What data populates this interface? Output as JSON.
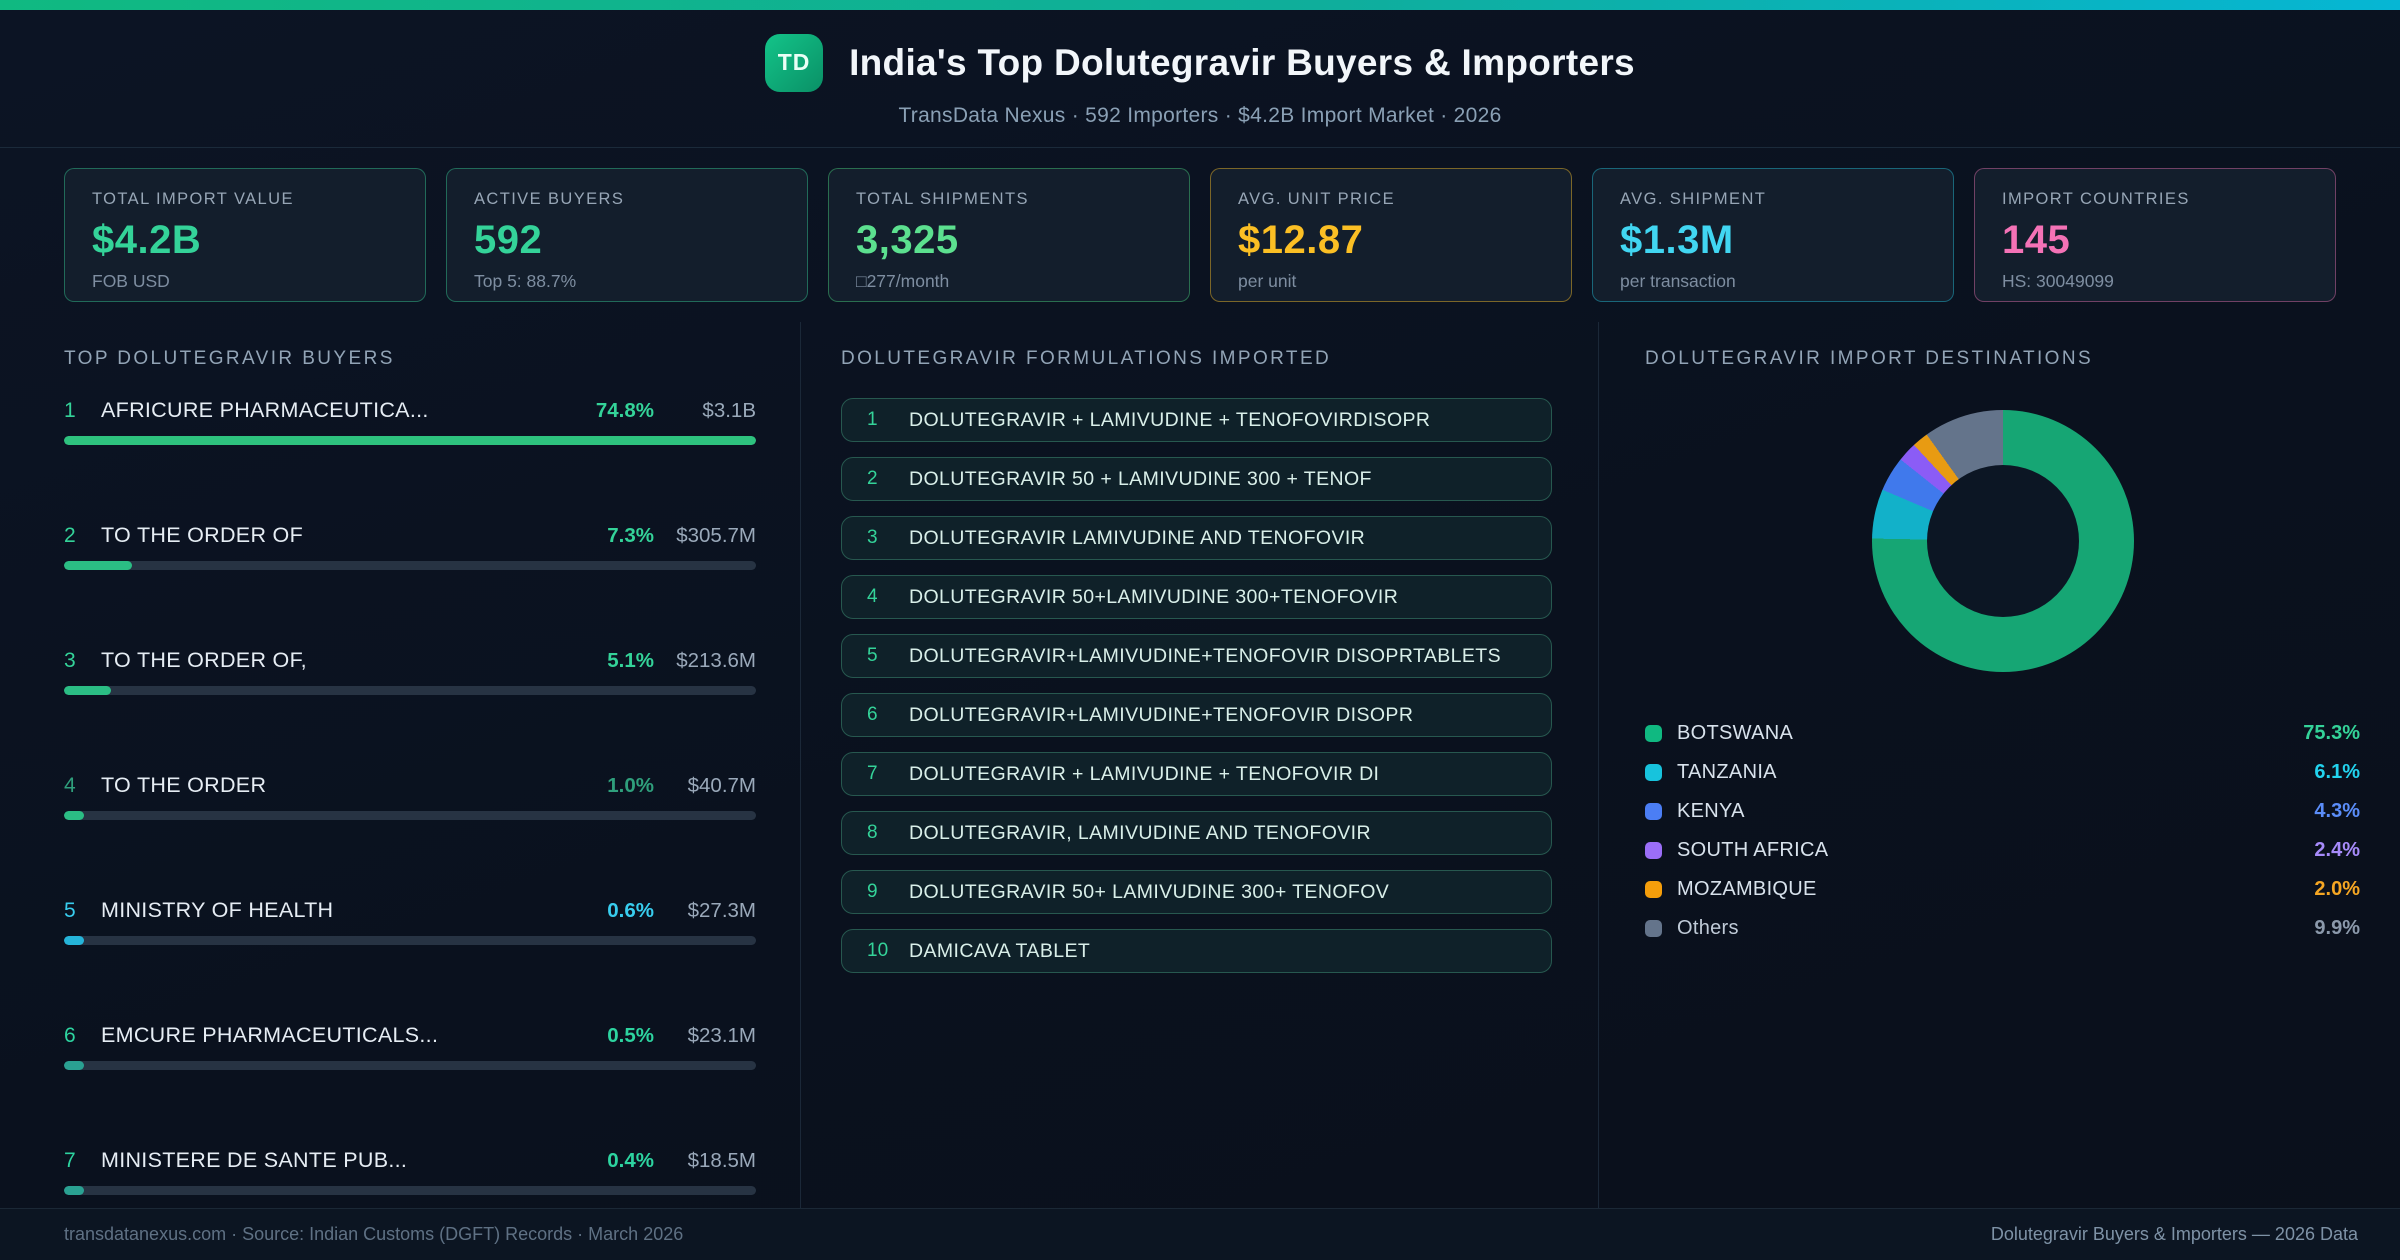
{
  "header": {
    "badge": "TD",
    "title": "India's Top Dolutegravir Buyers & Importers",
    "subtitle": "TransData Nexus · 592 Importers · $4.2B Import Market · 2026"
  },
  "stats": [
    {
      "label": "TOTAL IMPORT VALUE",
      "value": "$4.2B",
      "sub": "FOB USD",
      "accent": "#34d399",
      "border": "rgba(52,211,153,0.42)"
    },
    {
      "label": "ACTIVE BUYERS",
      "value": "592",
      "sub": "Top 5: 88.7%",
      "accent": "#34d399",
      "border": "rgba(52,211,153,0.42)"
    },
    {
      "label": "TOTAL SHIPMENTS",
      "value": "3,325",
      "sub": "□277/month",
      "accent": "#5ce08f",
      "border": "rgba(74,222,128,0.42)"
    },
    {
      "label": "AVG. UNIT PRICE",
      "value": "$12.87",
      "sub": "per unit",
      "accent": "#fbbf24",
      "border": "rgba(251,191,36,0.45)"
    },
    {
      "label": "AVG. SHIPMENT",
      "value": "$1.3M",
      "sub": "per transaction",
      "accent": "#41d6f2",
      "border": "rgba(34,211,238,0.40)"
    },
    {
      "label": "IMPORT COUNTRIES",
      "value": "145",
      "sub": "HS: 30049099",
      "accent": "#f472b6",
      "border": "rgba(244,114,182,0.42)"
    }
  ],
  "buyers": {
    "heading": "TOP DOLUTEGRAVIR BUYERS",
    "max_pct": 74.8,
    "rows": [
      {
        "rank": "1",
        "name": "AFRICURE PHARMACEUTICA...",
        "pct": "74.8%",
        "value": "$3.1B",
        "pct_num": 74.8,
        "color": "#34d399",
        "bar": "#2ec27e"
      },
      {
        "rank": "2",
        "name": "TO THE ORDER OF",
        "pct": "7.3%",
        "value": "$305.7M",
        "pct_num": 7.3,
        "color": "#34d399",
        "bar": "#2bbd84"
      },
      {
        "rank": "3",
        "name": "TO THE ORDER OF,",
        "pct": "5.1%",
        "value": "$213.6M",
        "pct_num": 5.1,
        "color": "#34d399",
        "bar": "#2bbd84"
      },
      {
        "rank": "4",
        "name": "TO THE ORDER",
        "pct": "1.0%",
        "value": "$40.7M",
        "pct_num": 1.0,
        "color": "#2f9f7c",
        "bar": "#2bbd84"
      },
      {
        "rank": "5",
        "name": "MINISTRY OF HEALTH",
        "pct": "0.6%",
        "value": "$27.3M",
        "pct_num": 0.6,
        "color": "#38cdee",
        "bar": "#25b4d9"
      },
      {
        "rank": "6",
        "name": "EMCURE PHARMACEUTICALS...",
        "pct": "0.5%",
        "value": "$23.1M",
        "pct_num": 0.5,
        "color": "#2dd4a0",
        "bar": "#2aa192"
      },
      {
        "rank": "7",
        "name": "MINISTERE DE SANTE PUB...",
        "pct": "0.4%",
        "value": "$18.5M",
        "pct_num": 0.4,
        "color": "#2dd4a0",
        "bar": "#2aa192"
      }
    ]
  },
  "formulations": {
    "heading": "DOLUTEGRAVIR FORMULATIONS IMPORTED",
    "items": [
      {
        "rank": "1",
        "text": "DOLUTEGRAVIR + LAMIVUDINE + TENOFOVIRDISOPR"
      },
      {
        "rank": "2",
        "text": "DOLUTEGRAVIR 50 + LAMIVUDINE 300 + TENOF"
      },
      {
        "rank": "3",
        "text": "DOLUTEGRAVIR LAMIVUDINE AND TENOFOVIR"
      },
      {
        "rank": "4",
        "text": "DOLUTEGRAVIR 50+LAMIVUDINE 300+TENOFOVIR"
      },
      {
        "rank": "5",
        "text": "DOLUTEGRAVIR+LAMIVUDINE+TENOFOVIR DISOPRTABLETS"
      },
      {
        "rank": "6",
        "text": "DOLUTEGRAVIR+LAMIVUDINE+TENOFOVIR DISOPR"
      },
      {
        "rank": "7",
        "text": "DOLUTEGRAVIR + LAMIVUDINE + TENOFOVIR DI"
      },
      {
        "rank": "8",
        "text": "DOLUTEGRAVIR, LAMIVUDINE AND TENOFOVIR"
      },
      {
        "rank": "9",
        "text": "DOLUTEGRAVIR 50+ LAMIVUDINE 300+ TENOFOV"
      },
      {
        "rank": "10",
        "text": "DAMICAVA TABLET"
      }
    ]
  },
  "destinations": {
    "heading": "DOLUTEGRAVIR IMPORT DESTINATIONS"
  },
  "chart_data": {
    "type": "pie",
    "donut": true,
    "title": "DOLUTEGRAVIR IMPORT DESTINATIONS",
    "labels": [
      "BOTSWANA",
      "TANZANIA",
      "KENYA",
      "SOUTH AFRICA",
      "MOZAMBIQUE",
      "Others"
    ],
    "values": [
      75.3,
      6.1,
      4.3,
      2.4,
      2.0,
      9.9
    ],
    "display_percents": [
      "75.3%",
      "6.1%",
      "4.3%",
      "2.4%",
      "2.0%",
      "9.9%"
    ],
    "slice_colors": [
      "#16a674",
      "#12b1c9",
      "#4079ec",
      "#8b5cf6",
      "#e89b12",
      "#64748b"
    ],
    "legend_swatch_colors": [
      "#10b981",
      "#17c3dd",
      "#4b7ef5",
      "#9b6ef7",
      "#f59e0b",
      "#64748b"
    ],
    "legend_value_colors": [
      "#34d399",
      "#22d3ee",
      "#5b8df8",
      "#a78bfa",
      "#f5a623",
      "#8b99ab"
    ],
    "legend_position": "bottom",
    "start_angle_deg": 0,
    "direction": "clockwise"
  },
  "footer": {
    "left": "transdatanexus.com · Source: Indian Customs (DGFT) Records · March 2026",
    "right": "Dolutegravir Buyers & Importers — 2026 Data"
  }
}
